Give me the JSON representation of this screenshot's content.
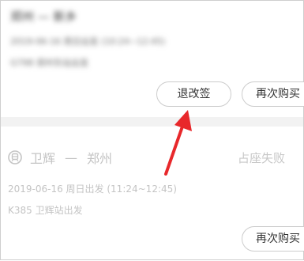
{
  "colors": {
    "annotation_arrow": "#e8282b",
    "separator": "#f2f2f2",
    "muted_text": "#c4c4c4"
  },
  "top_order": {
    "route_blurred": "郑州 — 新乡",
    "date_blurred": "2019-06-16 周日出发 (10:24~12:45)",
    "station_blurred": "G798 郑州东站出发",
    "change_label": "退改签",
    "rebuy_label": "再次购买"
  },
  "bottom_order": {
    "icon": "train-icon",
    "from": "卫辉",
    "dash": "—",
    "to": "郑州",
    "status": "占座失败",
    "date_line": "2019-06-16 周日出发 (11:24~12:45)",
    "station_line": "K385 卫辉站出发",
    "rebuy_label": "再次购买"
  }
}
